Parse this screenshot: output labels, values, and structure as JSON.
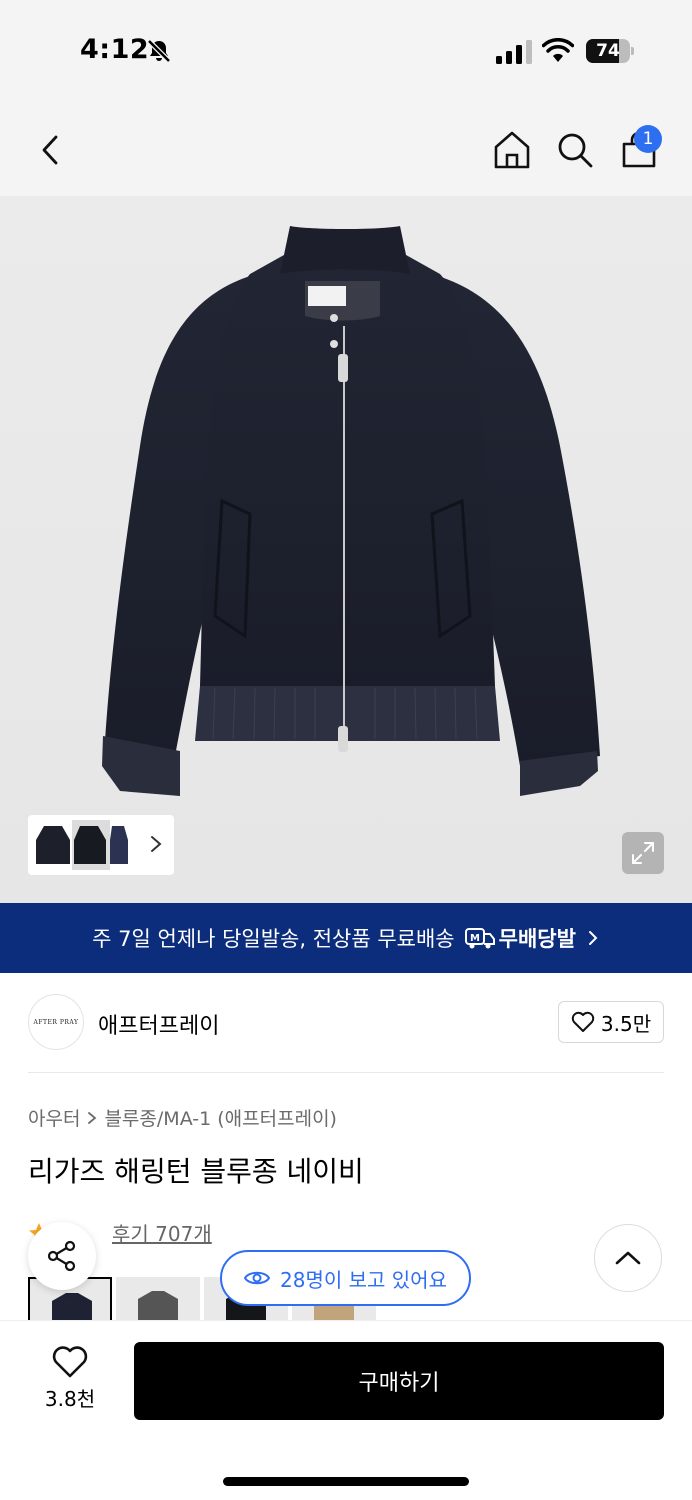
{
  "status_bar": {
    "time": "4:12",
    "battery": "74",
    "battery_level": 0.74
  },
  "header": {
    "cart_badge": "1"
  },
  "image": {
    "alt": "AFTER PRAY navy wool jacket"
  },
  "shipping_banner": {
    "text": "주 7일 언제나 당일발송, 전상품 무료배송",
    "logo_text": "무배당발",
    "logo_mark": "M"
  },
  "brand": {
    "logo_text": "AFTER PRAY",
    "name": "애프터프레이",
    "likes": "3.5만"
  },
  "breadcrumb": {
    "category": "아우터",
    "subcategory": "블루종/MA-1 (애프터프레이)"
  },
  "product": {
    "title": "리가즈 해링턴 블루종 네이비"
  },
  "rating": {
    "reviews": "후기 707개"
  },
  "viewers": {
    "text": "28명이 보고 있어요"
  },
  "bottom_bar": {
    "wish_count": "3.8천",
    "buy_label": "구매하기"
  },
  "colors": {
    "navy": "#1e2233",
    "accent_blue": "#2f6ef2",
    "banner_blue": "#0c2c7c"
  }
}
